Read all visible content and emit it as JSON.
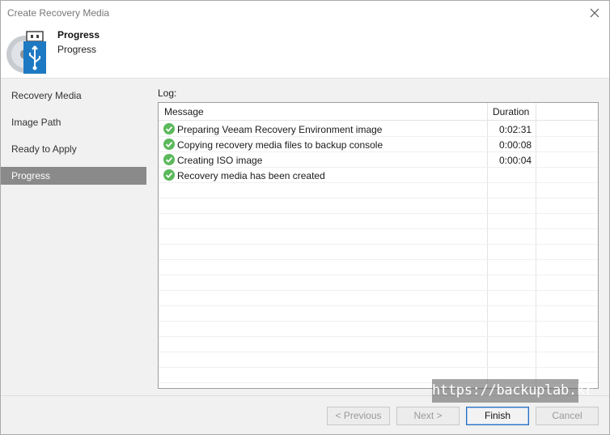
{
  "window": {
    "title": "Create Recovery Media"
  },
  "header": {
    "title": "Progress",
    "subtitle": "Progress"
  },
  "nav": {
    "items": [
      {
        "label": "Recovery Media"
      },
      {
        "label": "Image Path"
      },
      {
        "label": "Ready to Apply"
      },
      {
        "label": "Progress"
      }
    ]
  },
  "log": {
    "label": "Log:",
    "columns": {
      "message": "Message",
      "duration": "Duration"
    },
    "rows": [
      {
        "status": "success",
        "message": "Preparing Veeam Recovery Environment image",
        "duration": "0:02:31"
      },
      {
        "status": "success",
        "message": "Copying recovery media files to backup console",
        "duration": "0:00:08"
      },
      {
        "status": "success",
        "message": "Creating ISO image",
        "duration": "0:00:04"
      },
      {
        "status": "success",
        "message": "Recovery media has been created",
        "duration": ""
      }
    ]
  },
  "buttons": {
    "previous": "< Previous",
    "next": "Next >",
    "finish": "Finish",
    "cancel": "Cancel"
  },
  "watermark": "https://backuplab.kr",
  "colors": {
    "success": "#5cb85c",
    "nav_active": "#8a8a8a",
    "primary_border": "#2b6fbf"
  }
}
